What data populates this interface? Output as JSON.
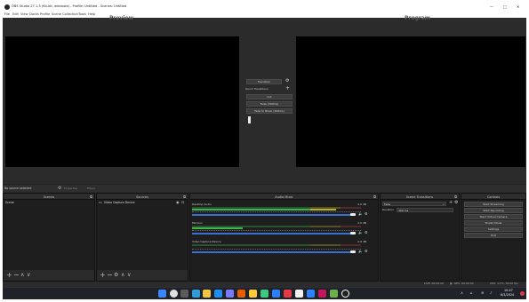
{
  "window": {
    "title": "OBS Studio 27.1.3 (64-bit, windows) - Profile: Untitled - Scenes: Untitled"
  },
  "menu": [
    "File",
    "Edit",
    "View",
    "Docks",
    "Profile",
    "Scene Collection",
    "Tools",
    "Help"
  ],
  "window_controls": {
    "minimize": "—",
    "maximize": "□",
    "close": "✕"
  },
  "preview": {
    "label": "Preview"
  },
  "program": {
    "label": "Program"
  },
  "transition": {
    "transition_button": "Transition",
    "quick_transitions_label": "Quick Transitions",
    "options": [
      "Cut",
      "Fade (300ms)",
      "Fade to Black (300ms)"
    ]
  },
  "source_toolbar": {
    "no_source": "No source selected",
    "properties": "Properties",
    "filters": "Filters"
  },
  "docks": {
    "scenes": {
      "title": "Scenes",
      "items": [
        "Scene"
      ]
    },
    "sources": {
      "title": "Sources",
      "items": [
        "Video Capture Device"
      ]
    },
    "mixer": {
      "title": "Audio Mixer",
      "tracks": [
        {
          "name": "Desktop Audio",
          "db": "0.0 dB",
          "level": 0.85
        },
        {
          "name": "Mic/Aux",
          "db": "0.0 dB",
          "level": 0.3
        },
        {
          "name": "Video Capture Device",
          "db": "0.0 dB",
          "level": 0.0
        }
      ]
    },
    "transitions": {
      "title": "Scene Transitions",
      "selected": "Fade",
      "duration_label": "Duration",
      "duration": "300 ms"
    },
    "controls": {
      "title": "Controls",
      "buttons": [
        "Start Streaming",
        "Start Recording",
        "Start Virtual Camera",
        "Studio Mode",
        "Settings",
        "Exit"
      ]
    }
  },
  "status": {
    "text": "CPU: 1.1%, 30.00 fps",
    "live": "LIVE: 00:00:00",
    "rec": "REC: 00:00:00",
    "fps_drop": "Frames: 0.0%"
  },
  "taskbar": {
    "time": "10:47",
    "date": "6/3/2024",
    "app_colors": [
      "#3a86ff",
      "#f4c542",
      "#2d9cdb",
      "#e0e0e0",
      "#1f8ef1",
      "#7a7aff",
      "#e85d04",
      "#ffca3a",
      "#3ac97e",
      "#2d7ff9",
      "#e63946",
      "#f1f1f1",
      "#2b83ff",
      "#c2185b",
      "#6ab04c"
    ]
  }
}
